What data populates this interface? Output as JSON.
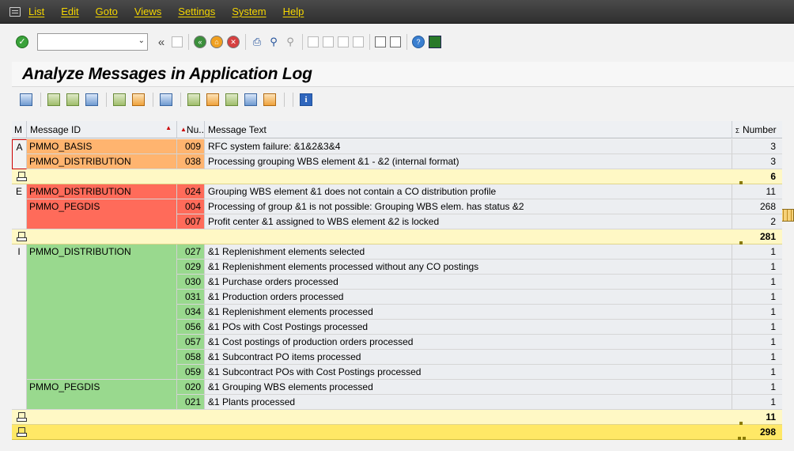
{
  "menu": [
    "List",
    "Edit",
    "Goto",
    "Views",
    "Settings",
    "System",
    "Help"
  ],
  "toolbar": {
    "command_value": "",
    "collapse_glyph": "«"
  },
  "title": "Analyze Messages in Application Log",
  "grid": {
    "headers": {
      "type": "M",
      "id": "Message ID",
      "num": "Nu...",
      "text": "Message Text",
      "count": "Number"
    },
    "rows": [
      {
        "type": "A",
        "id": "PMMO_BASIS",
        "num": "009",
        "text": "RFC system failure: &1&2&3&4",
        "count": "3"
      },
      {
        "type": "",
        "id": "PMMO_DISTRIBUTION",
        "num": "038",
        "text": "Processing grouping WBS element &1  - &2 (internal format)",
        "count": "3"
      },
      {
        "type": "E",
        "id": "PMMO_DISTRIBUTION",
        "num": "024",
        "text": "Grouping WBS element &1 does not contain a CO distribution profile",
        "count": "11"
      },
      {
        "type": "",
        "id": "PMMO_PEGDIS",
        "num": "004",
        "text": "Processing of group &1 is not possible: Grouping WBS elem. has status &2",
        "count": "268"
      },
      {
        "type": "",
        "id": "",
        "num": "007",
        "text": "Profit center &1 assigned to WBS element &2 is locked",
        "count": "2"
      },
      {
        "type": "I",
        "id": "PMMO_DISTRIBUTION",
        "num": "027",
        "text": "&1 Replenishment elements selected",
        "count": "1"
      },
      {
        "type": "",
        "id": "",
        "num": "029",
        "text": "&1 Replenishment elements processed without any CO postings",
        "count": "1"
      },
      {
        "type": "",
        "id": "",
        "num": "030",
        "text": "&1 Purchase orders processed",
        "count": "1"
      },
      {
        "type": "",
        "id": "",
        "num": "031",
        "text": "&1 Production orders processed",
        "count": "1"
      },
      {
        "type": "",
        "id": "",
        "num": "034",
        "text": "&1 Replenishment elements processed",
        "count": "1"
      },
      {
        "type": "",
        "id": "",
        "num": "056",
        "text": "&1 POs with Cost Postings processed",
        "count": "1"
      },
      {
        "type": "",
        "id": "",
        "num": "057",
        "text": "&1 Cost postings of production orders processed",
        "count": "1"
      },
      {
        "type": "",
        "id": "",
        "num": "058",
        "text": "&1 Subcontract PO items processed",
        "count": "1"
      },
      {
        "type": "",
        "id": "",
        "num": "059",
        "text": "&1 Subcontract POs with Cost Postings processed",
        "count": "1"
      },
      {
        "type": "",
        "id": "PMMO_PEGDIS",
        "num": "020",
        "text": "&1 Grouping WBS elements processed",
        "count": "1"
      },
      {
        "type": "",
        "id": "",
        "num": "021",
        "text": "&1 Plants processed",
        "count": "1"
      }
    ],
    "subtotals": [
      "6",
      "281",
      "11"
    ],
    "grand_total": "298"
  },
  "colors": {
    "warning": "#ffb46f",
    "error": "#ff6b5a",
    "info": "#99d98e",
    "subtotal": "#fff8c5",
    "total": "#ffe866"
  },
  "icons": [
    "enter-icon",
    "back-icon",
    "exit-icon",
    "cancel-icon",
    "print-icon",
    "find-icon",
    "help-icon",
    "layout-icon"
  ]
}
